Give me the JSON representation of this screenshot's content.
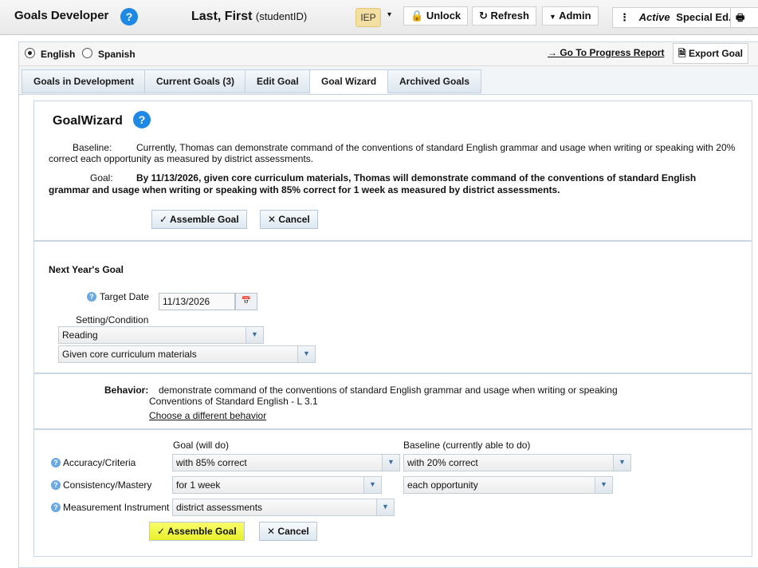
{
  "app": {
    "title": "Goals Developer",
    "help": "?",
    "student_name": "Last, First",
    "student_id": "(studentID)",
    "iep_badge": "IEP",
    "caret": "▾",
    "buttons": {
      "unlock": "Unlock",
      "refresh": "Refresh",
      "admin": "Admin"
    },
    "status_menu": "⋮",
    "status": "Active",
    "program": "Special Ed."
  },
  "lang": {
    "english": "English",
    "spanish": "Spanish",
    "selected": "English"
  },
  "actions": {
    "progress_report": "Go To Progress Report",
    "export_goal": "Export Goal"
  },
  "tabs": [
    {
      "label": "Goals in Development"
    },
    {
      "label": "Current Goals (3)"
    },
    {
      "label": "Edit Goal"
    },
    {
      "label": "Goal Wizard",
      "active": true
    },
    {
      "label": "Archived Goals"
    }
  ],
  "wizard": {
    "title": "GoalWizard",
    "baseline_label": "Baseline:",
    "baseline_text_1": "Currently, Thomas can demonstrate command of the conventions of standard English grammar and usage when writing or speaking with 20%",
    "baseline_text_2": "correct each opportunity as measured by district assessments.",
    "goal_label": "Goal:",
    "goal_text_1": "By 11/13/2026, given core curriculum materials, Thomas will demonstrate command of the conventions of standard English",
    "goal_text_2": "grammar and usage when writing or speaking with 85% correct for 1 week as measured by district assessments.",
    "assemble_label": "Assemble Goal",
    "cancel_label": "Cancel"
  },
  "next_year": {
    "heading": "Next Year's Goal",
    "target_date_label": "Target Date",
    "target_date": "11/13/2026",
    "setting_label": "Setting/Condition",
    "setting_value": "Reading",
    "condition_value": "Given core curriculum materials"
  },
  "behavior": {
    "label": "Behavior:",
    "text": "demonstrate command of the conventions of standard English grammar and usage when writing or speaking",
    "standard": "Conventions of Standard English - L 3.1",
    "change_link": "Choose a different behavior"
  },
  "criteria": {
    "goal_header": "Goal (will do)",
    "baseline_header": "Baseline (currently able to do)",
    "rows": [
      {
        "label": "Accuracy/Criteria",
        "goal": "with 85% correct",
        "baseline": "with 20% correct"
      },
      {
        "label": "Consistency/Mastery",
        "goal": "for 1 week",
        "baseline": "each opportunity"
      },
      {
        "label": "Measurement Instrument",
        "goal": "district assessments"
      }
    ],
    "assemble_label": "Assemble Goal",
    "cancel_label": "Cancel"
  },
  "colors": {
    "highlight": "#eef23a",
    "help_blue": "#1e88e5",
    "tab_border": "#c3d0de"
  }
}
